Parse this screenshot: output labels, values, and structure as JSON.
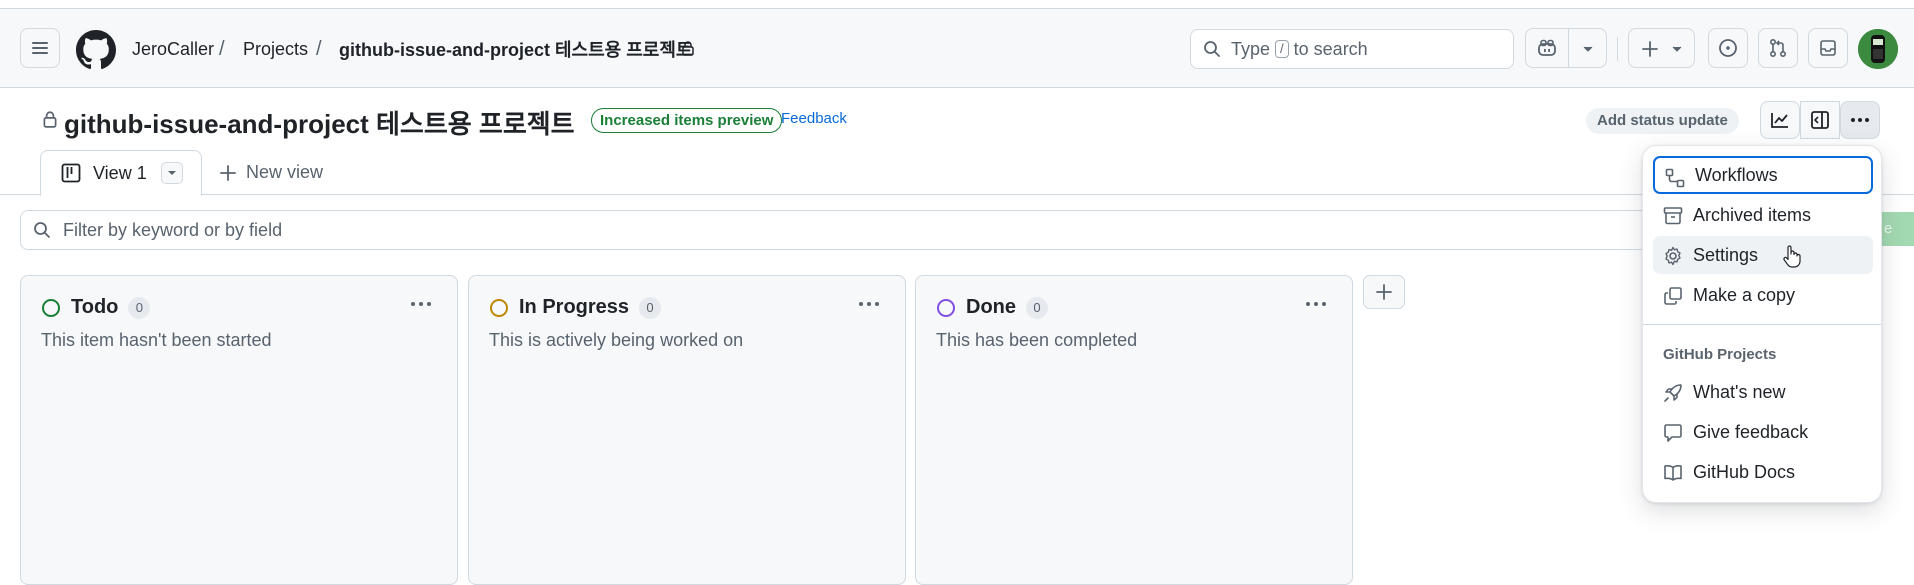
{
  "header": {
    "owner": "JeroCaller",
    "projects": "Projects",
    "repo_title": "github-issue-and-project 테스트용 프로젝트",
    "search_type": "Type",
    "search_key": "/",
    "search_suffix": "to search"
  },
  "project": {
    "title": "github-issue-and-project 테스트용 프로젝트",
    "badge": "Increased items preview",
    "feedback": "Feedback",
    "status_update": "Add status update"
  },
  "tabs": {
    "view1": "View 1",
    "new_view": "New view"
  },
  "filter": {
    "placeholder": "Filter by keyword or by field"
  },
  "columns": [
    {
      "name": "Todo",
      "count": "0",
      "description": "This item hasn't been started",
      "color": "#1a7f37"
    },
    {
      "name": "In Progress",
      "count": "0",
      "description": "This is actively being worked on",
      "color": "#bf8700"
    },
    {
      "name": "Done",
      "count": "0",
      "description": "This has been completed",
      "color": "#8250df"
    }
  ],
  "menu": {
    "workflows": "Workflows",
    "archived": "Archived items",
    "settings": "Settings",
    "copy": "Make a copy",
    "group_title": "GitHub Projects",
    "whats_new": "What's new",
    "give_feedback": "Give feedback",
    "docs": "GitHub Docs"
  },
  "colors": {
    "accent": "#0969da",
    "success": "#1a7f37",
    "border": "#d1d9e0",
    "muted": "#59636e"
  }
}
